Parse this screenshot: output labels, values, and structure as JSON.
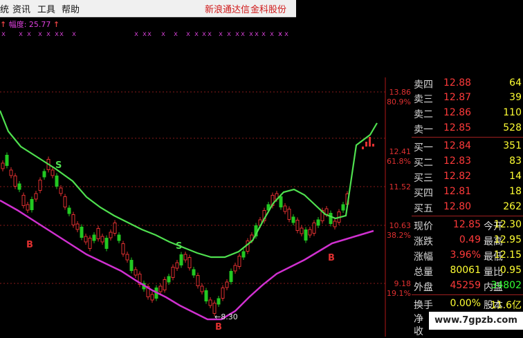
{
  "menu": [
    {
      "label": "统",
      "name": "menu-system"
    },
    {
      "label": "资讯",
      "name": "menu-news"
    },
    {
      "label": "工具",
      "name": "menu-tools"
    },
    {
      "label": "帮助",
      "name": "menu-help"
    }
  ],
  "brand": {
    "broker_left": "新浪通达信",
    "broker_right": "金科股份"
  },
  "indicator": {
    "arrow_left": "↑",
    "label": "幅度: 25.77",
    "arrow_right": "↑"
  },
  "x_markers": [
    "x",
    "x x",
    "x",
    "x x",
    "x",
    "x",
    "x x",
    "x",
    "x",
    "x",
    "x x",
    "x",
    "x",
    "x x",
    "x",
    "x x",
    "x",
    "x x x",
    "x",
    "x"
  ],
  "axis": {
    "price_labels": [
      "13.86",
      "12.41",
      "11.52",
      "10.63",
      "9.18"
    ],
    "pct_labels": [
      "80.9%",
      "61.8%",
      "38.2%",
      "19.1%"
    ]
  },
  "chart_markers": {
    "buy": "B",
    "sell": "S",
    "low_price": "←8.30"
  },
  "quote": {
    "asks": [
      {
        "label": "卖四",
        "price": "12.88",
        "vol": "64"
      },
      {
        "label": "卖三",
        "price": "12.87",
        "vol": "39"
      },
      {
        "label": "卖二",
        "price": "12.86",
        "vol": "110"
      },
      {
        "label": "卖一",
        "price": "12.85",
        "vol": "528"
      }
    ],
    "bids": [
      {
        "label": "买一",
        "price": "12.84",
        "vol": "351"
      },
      {
        "label": "买二",
        "price": "12.83",
        "vol": "83"
      },
      {
        "label": "买三",
        "price": "12.82",
        "vol": "14"
      },
      {
        "label": "买四",
        "price": "12.81",
        "vol": "18"
      },
      {
        "label": "买五",
        "price": "12.80",
        "vol": "262"
      }
    ],
    "stats": [
      {
        "l1": "现价",
        "v1": "12.85",
        "c1": "#ff3a3a",
        "l2": "今开",
        "v2": "12.30",
        "c2": "#ffff33"
      },
      {
        "l1": "涨跌",
        "v1": "0.49",
        "c1": "#ff3a3a",
        "l2": "最高",
        "v2": "12.95",
        "c2": "#ffff33"
      },
      {
        "l1": "涨幅",
        "v1": "3.96%",
        "c1": "#ff3a3a",
        "l2": "最低",
        "v2": "12.15",
        "c2": "#ffff33"
      },
      {
        "l1": "总量",
        "v1": "80061",
        "c1": "#ffff33",
        "l2": "量比",
        "v2": "0.95",
        "c2": "#ffff33"
      },
      {
        "l1": "外盘",
        "v1": "45259",
        "c1": "#ff3a3a",
        "l2": "内盘",
        "v2": "34802",
        "c2": "#33ff33"
      }
    ],
    "extra": [
      {
        "l1": "换手",
        "v1": "0.00%",
        "c1": "#ffff33",
        "l2": "股本",
        "v2": "11.6亿",
        "c2": "#ffff33"
      },
      {
        "l1": "净",
        "v1": "",
        "c1": "#ffff33",
        "l2": "",
        "v2": "",
        "c2": "#ffff33"
      },
      {
        "l1": "收",
        "v1": "",
        "c1": "#ffff33",
        "l2": "",
        "v2": "",
        "c2": "#ffff33"
      }
    ]
  },
  "watermark": "www.7gpzb.com"
}
